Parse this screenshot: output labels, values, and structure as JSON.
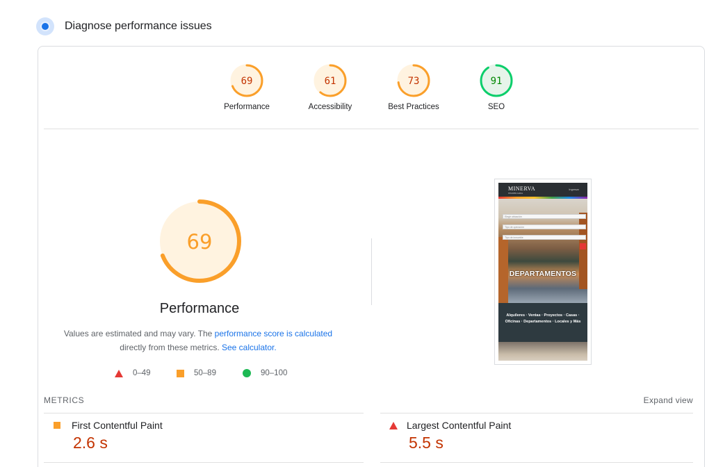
{
  "header": {
    "title": "Diagnose performance issues",
    "icon": "lighthouse-icon"
  },
  "gauges": [
    {
      "score": "69",
      "label": "Performance",
      "value": 69,
      "color": "#fa9f2a",
      "fill": "#fff3e0",
      "text_color": "#c33300"
    },
    {
      "score": "61",
      "label": "Accessibility",
      "value": 61,
      "color": "#fa9f2a",
      "fill": "#fff3e0",
      "text_color": "#c33300"
    },
    {
      "score": "73",
      "label": "Best Practices",
      "value": 73,
      "color": "#fa9f2a",
      "fill": "#fff3e0",
      "text_color": "#c33300"
    },
    {
      "score": "91",
      "label": "SEO",
      "value": 91,
      "color": "#0cce6b",
      "fill": "#e6f4ea",
      "text_color": "#008800"
    }
  ],
  "performance": {
    "score": "69",
    "value": 69,
    "title": "Performance",
    "note_prefix": "Values are estimated and may vary. The ",
    "note_link": "performance score is calculated",
    "note_middle": "directly from these metrics. ",
    "note_link2": "See calculator."
  },
  "legend": [
    {
      "shape": "triangle",
      "range": "0–49",
      "color": "#e53935"
    },
    {
      "shape": "square",
      "range": "50–89",
      "color": "#fa9f2a"
    },
    {
      "shape": "circle",
      "range": "90–100",
      "color": "#1db954"
    }
  ],
  "screenshot": {
    "logo": "MINERVA",
    "logo_sub": "INMOBILIARIA",
    "nav": "Ingresar",
    "select1": "Elegir ubicación",
    "select2": "Tipo de operación",
    "select3": "Tipo de inmueble",
    "headline": "DEPARTAMENTOS",
    "tagline": "Alquileres · Ventas · Proyectos · Casas · Oficinas · Departamentos · Locales y Más"
  },
  "metrics": {
    "title": "METRICS",
    "expand": "Expand view",
    "items": [
      {
        "name": "First Contentful Paint",
        "value": "2.6 s",
        "status": "average"
      },
      {
        "name": "Largest Contentful Paint",
        "value": "5.5 s",
        "status": "fail"
      }
    ]
  }
}
